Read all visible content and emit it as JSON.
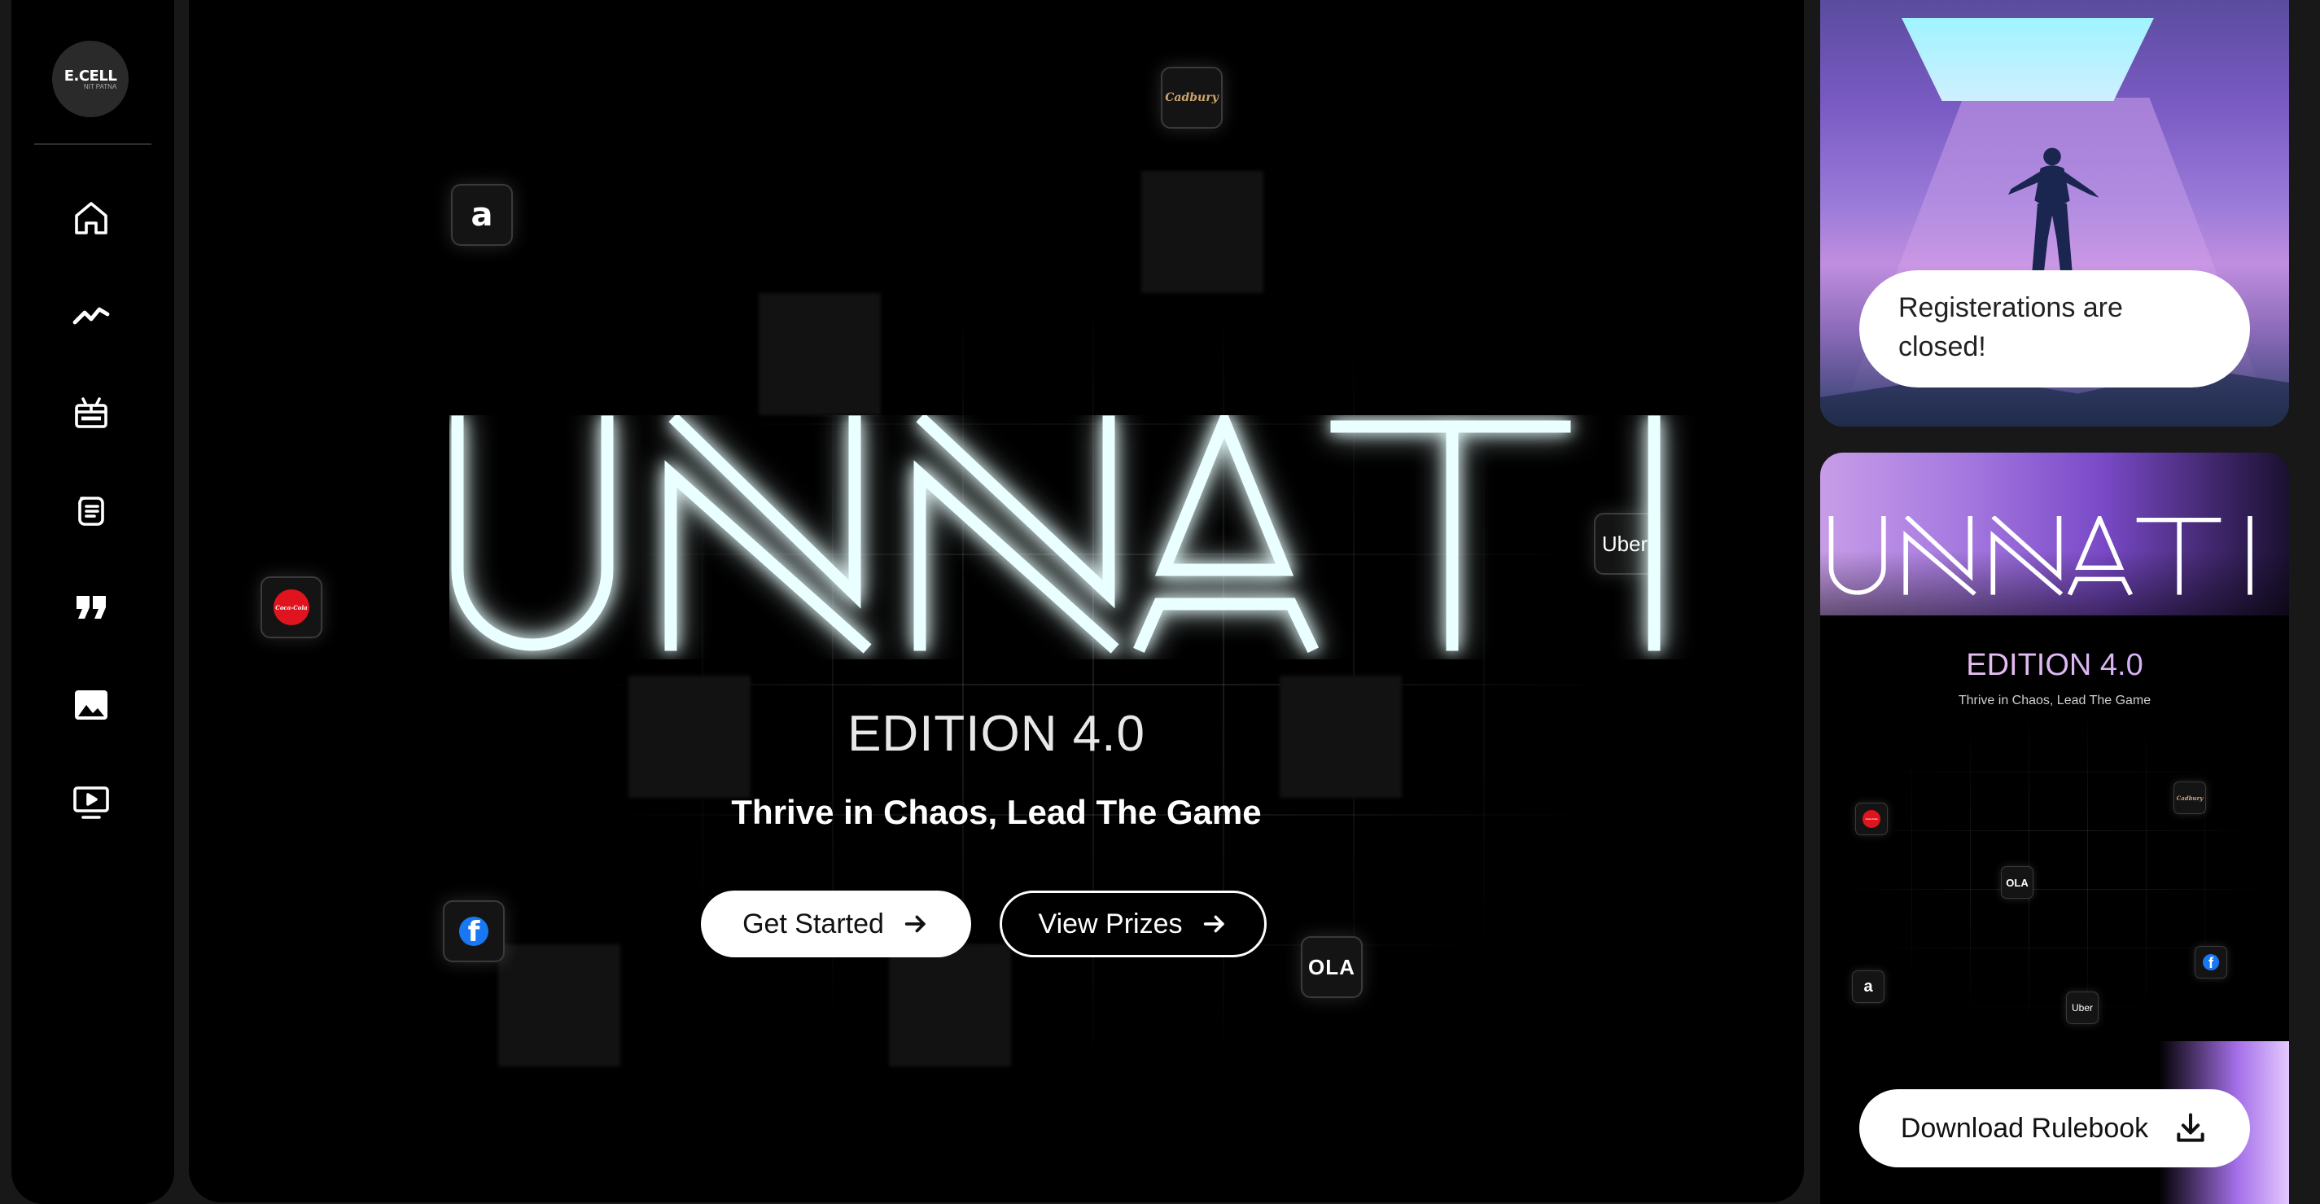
{
  "sidebar": {
    "logo": {
      "text": "E.CELL",
      "tag": "NIT PATNA"
    },
    "items": [
      {
        "icon": "home-icon"
      },
      {
        "icon": "trend-icon"
      },
      {
        "icon": "gift-icon"
      },
      {
        "icon": "document-icon"
      },
      {
        "icon": "quote-icon"
      },
      {
        "icon": "image-icon"
      },
      {
        "icon": "video-icon"
      }
    ]
  },
  "hero": {
    "title": "UNNATI",
    "edition": "EDITION 4.0",
    "tagline": "Thrive in Chaos, Lead The Game",
    "primary_button": "Get Started",
    "secondary_button": "View Prizes",
    "brands": {
      "amazon": "a",
      "cadbury": "Cadbury",
      "uber": "Uber",
      "cocacola": "Coca-Cola",
      "facebook": "f",
      "ola": "OLA"
    }
  },
  "registration": {
    "message": "Registerations are closed!"
  },
  "rulebook": {
    "title": "UNNATI",
    "edition": "EDITION 4.0",
    "tagline": "Thrive in Chaos, Lead The Game",
    "brands": {
      "cocacola": "Coca-Cola",
      "cadbury": "Cadbury",
      "ola": "OLA",
      "facebook": "f",
      "amazon": "a",
      "uber": "Uber"
    },
    "download_label": "Download Rulebook"
  },
  "colors": {
    "background": "#181818",
    "panel": "#000000",
    "neon_glow": "#7fe6ff",
    "accent_purple": "#a46fe8"
  }
}
